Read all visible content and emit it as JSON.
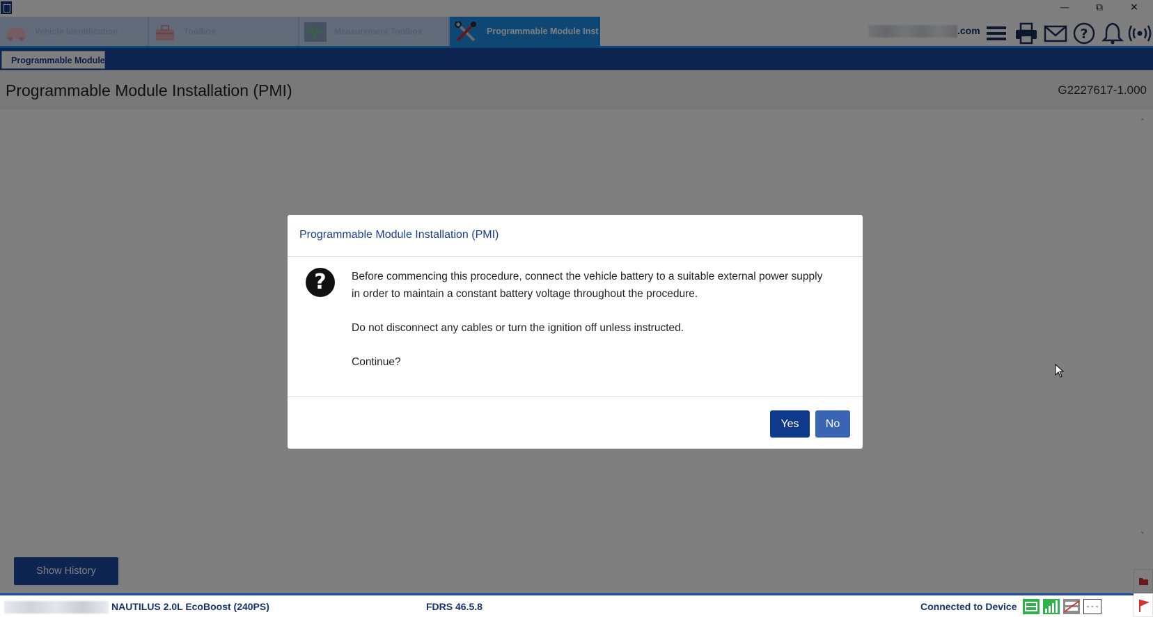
{
  "window": {
    "app_icon": "fdrs-app-icon",
    "minimize_glyph": "—",
    "restore_glyph": "⧉",
    "close_glyph": "✕"
  },
  "tabs": [
    {
      "label": "Vehicle Identification",
      "icon": "car-icon",
      "active": false
    },
    {
      "label": "Toolbox",
      "icon": "toolbox-icon",
      "active": false
    },
    {
      "label": "Measurement Toolbox",
      "icon": "waveform-icon",
      "active": false
    },
    {
      "label": "Programmable Module Inst",
      "icon": "tools-icon",
      "active": true
    }
  ],
  "header": {
    "email_suffix": ".com",
    "icons": [
      "menu-icon",
      "printer-icon",
      "mail-icon",
      "help-icon",
      "bell-icon",
      "wireless-icon"
    ]
  },
  "subtab": {
    "label": "Programmable Module"
  },
  "page": {
    "title": "Programmable Module Installation (PMI)",
    "doc_id": "G2227617-1.000",
    "show_history_label": "Show History",
    "scroll_up_glyph": "˄",
    "scroll_down_glyph": "˅"
  },
  "dialog": {
    "title": "Programmable Module Installation (PMI)",
    "icon": "question-icon",
    "icon_glyph": "?",
    "paragraphs": [
      "Before commencing this procedure, connect the vehicle battery to a suitable external power supply in order to maintain a constant battery voltage throughout the procedure.",
      "Do not disconnect any cables or turn the ignition off unless instructed.",
      "Continue?"
    ],
    "yes_label": "Yes",
    "no_label": "No"
  },
  "statusbar": {
    "vehicle": "NAUTILUS 2.0L EcoBoost (240PS)",
    "version": "FDRS 46.5.8",
    "connection": "Connected to Device",
    "dash_label": "---",
    "icons": [
      "vci-icon",
      "signal-icon",
      "network-icon"
    ]
  },
  "colors": {
    "accent_blue": "#1e8fe8",
    "navy": "#1d4ba3",
    "yes_button": "#0f3a8c",
    "no_button": "#3a65b4",
    "status_green": "#2db34a"
  }
}
